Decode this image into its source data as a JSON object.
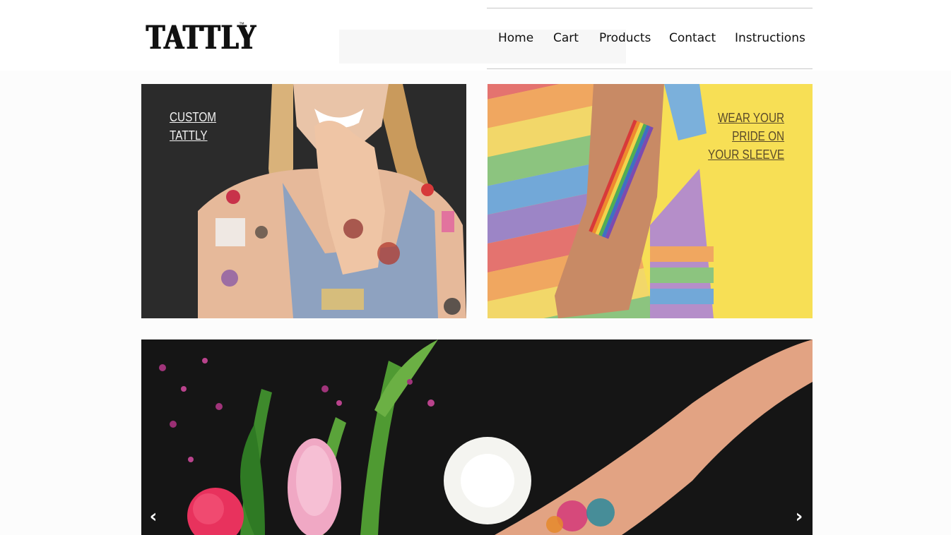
{
  "brand": {
    "logo_text": "TATTLY",
    "logo_tm": "™"
  },
  "nav": {
    "items": [
      {
        "label": "Home"
      },
      {
        "label": "Cart"
      },
      {
        "label": "Products"
      },
      {
        "label": "Contact"
      },
      {
        "label": "Instructions"
      }
    ]
  },
  "tiles": {
    "custom": {
      "line1": "CUSTOM",
      "line2": "TATTLY"
    },
    "pride": {
      "line1": "WEAR YOUR",
      "line2": "PRIDE ON",
      "line3": "YOUR SLEEVE"
    }
  },
  "slider": {
    "prev_icon": "chevron-left-icon",
    "next_icon": "chevron-right-icon",
    "prev_glyph": "‹",
    "next_glyph": "›"
  },
  "colors": {
    "accent_yellow": "#f5de52",
    "dark_background": "#2e2e2e",
    "nav_border": "#c8c8c8"
  }
}
